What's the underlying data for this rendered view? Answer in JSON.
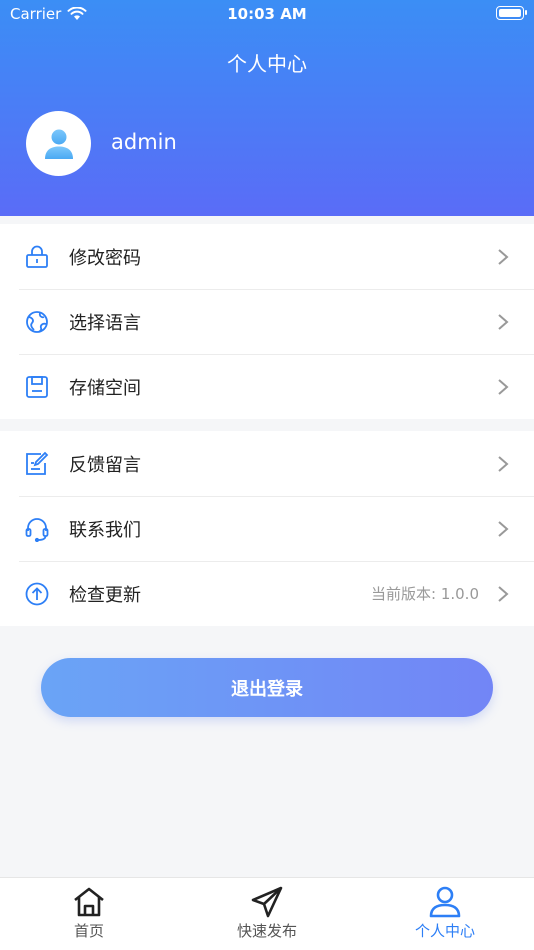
{
  "status_bar": {
    "carrier": "Carrier",
    "time": "10:03 AM"
  },
  "header": {
    "title": "个人中心",
    "username": "admin"
  },
  "menu_group1": [
    {
      "icon": "lock-icon",
      "label": "修改密码"
    },
    {
      "icon": "globe-icon",
      "label": "选择语言"
    },
    {
      "icon": "save-icon",
      "label": "存储空间"
    }
  ],
  "menu_group2": [
    {
      "icon": "feedback-icon",
      "label": "反馈留言"
    },
    {
      "icon": "headset-icon",
      "label": "联系我们"
    },
    {
      "icon": "upload-icon",
      "label": "检查更新",
      "value": "当前版本: 1.0.0"
    }
  ],
  "logout_label": "退出登录",
  "tabs": [
    {
      "icon": "home-icon",
      "label": "首页"
    },
    {
      "icon": "send-icon",
      "label": "快速发布"
    },
    {
      "icon": "user-icon",
      "label": "个人中心"
    }
  ],
  "colors": {
    "accent": "#2d7ff6",
    "header_top": "#3b8ef5",
    "header_bottom": "#5a6cf7"
  }
}
